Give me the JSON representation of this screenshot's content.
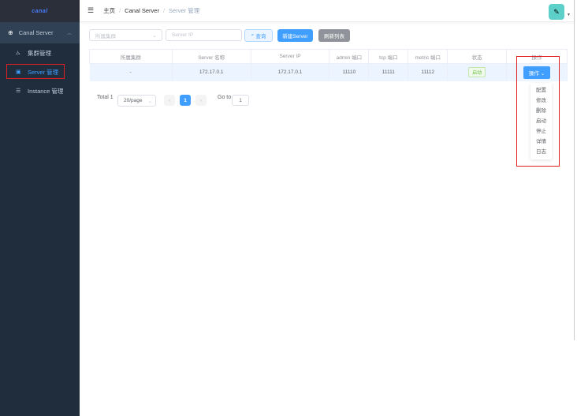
{
  "sidebar": {
    "logo": "canal",
    "group": "Canal Server",
    "items": [
      {
        "label": "集群管理",
        "icon": "cluster-icon"
      },
      {
        "label": "Server 管理",
        "icon": "server-icon",
        "active": true
      },
      {
        "label": "Instance 管理",
        "icon": "instance-icon"
      }
    ]
  },
  "header": {
    "breadcrumb": [
      "主页",
      "Canal Server",
      "Server 管理"
    ],
    "separator": "/"
  },
  "filters": {
    "cluster_placeholder": "所属集群",
    "ip_placeholder": "Server IP",
    "search_label": "查询",
    "new_label": "新建Server",
    "refresh_label": "刷新列表"
  },
  "table": {
    "columns": [
      "所属集群",
      "Server 名称",
      "Server IP",
      "admin 端口",
      "tcp 端口",
      "metric 端口",
      "状态",
      "操作"
    ],
    "rows": [
      {
        "cluster": "-",
        "name": "172.17.0.1",
        "ip": "172.17.0.1",
        "admin": "11110",
        "tcp": "11111",
        "metric": "11112",
        "status": "启动",
        "action": "操作"
      }
    ]
  },
  "dropdown": [
    "配置",
    "修改",
    "删除",
    "启动",
    "停止",
    "详情",
    "日志"
  ],
  "pagination": {
    "total": "Total 1",
    "page_size": "20/page",
    "current": "1",
    "goto_label": "Go to",
    "goto_value": "1"
  },
  "colors": {
    "accent": "#409eff",
    "sidebar": "#304156",
    "highlight": "#e02020"
  }
}
